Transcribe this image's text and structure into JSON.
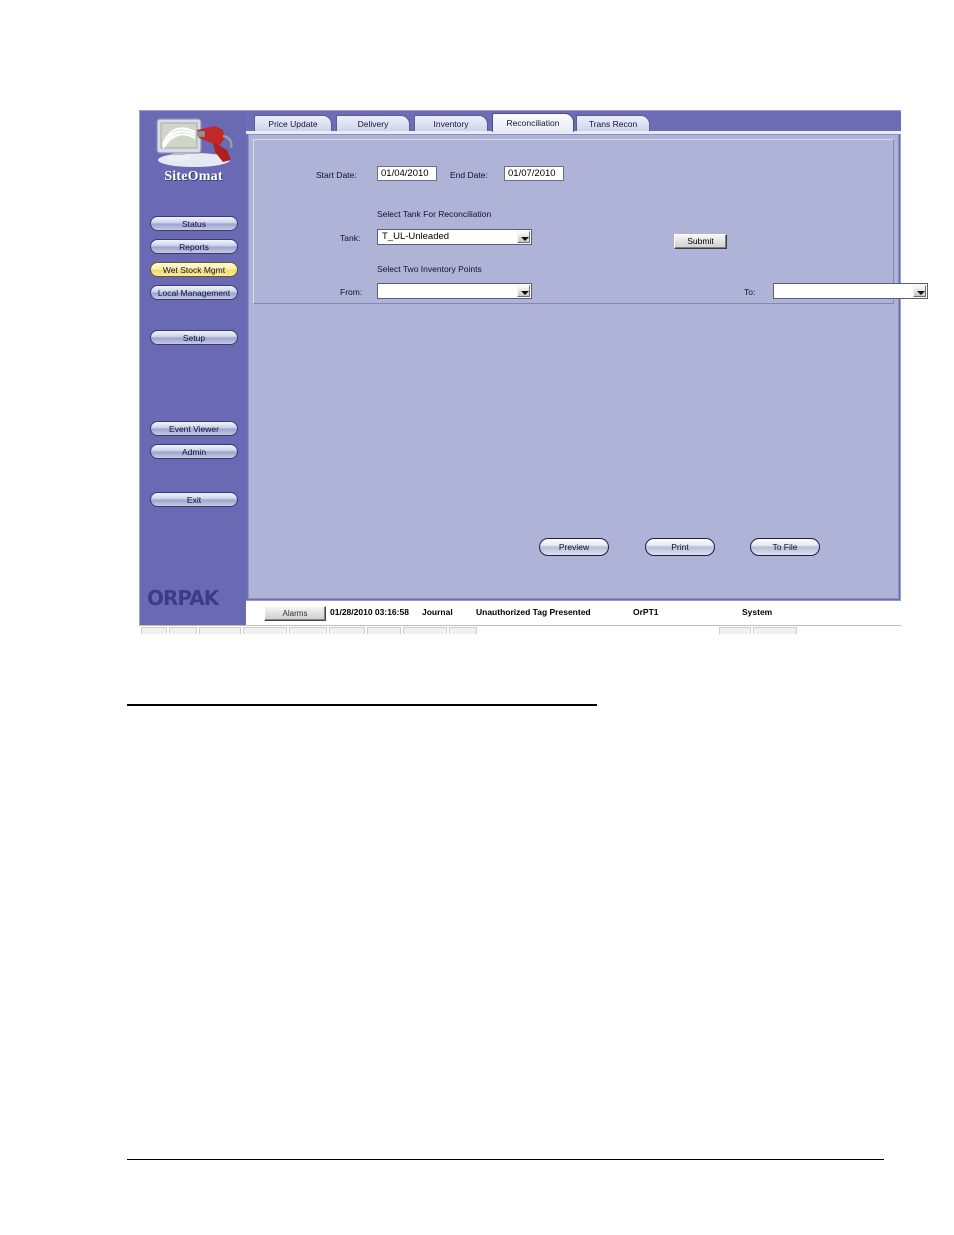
{
  "app": {
    "brand": "SiteOmat",
    "vendor_logo": "ORPAK",
    "logo_icon": "monitor-with-fuel-nozzle-icon"
  },
  "sidebar": {
    "items": [
      {
        "label": "Status",
        "active": false
      },
      {
        "label": "Reports",
        "active": false
      },
      {
        "label": "Wet Stock Mgmt",
        "active": true
      },
      {
        "label": "Local Management",
        "active": false
      },
      {
        "label": "Setup",
        "active": false
      },
      {
        "label": "Event Viewer",
        "active": false
      },
      {
        "label": "Admin",
        "active": false
      },
      {
        "label": "Exit",
        "active": false
      }
    ]
  },
  "tabs": [
    {
      "label": "Price Update",
      "active": false
    },
    {
      "label": "Delivery",
      "active": false
    },
    {
      "label": "Inventory",
      "active": false
    },
    {
      "label": "Reconciliation",
      "active": true
    },
    {
      "label": "Trans Recon",
      "active": false
    }
  ],
  "form": {
    "start_date_label": "Start Date:",
    "start_date_value": "01/04/2010",
    "end_date_label": "End Date:",
    "end_date_value": "01/07/2010",
    "tank_section_title": "Select Tank For Reconciliation",
    "tank_label": "Tank:",
    "tank_value": "T_UL-Unleaded",
    "submit_label": "Submit",
    "inventory_section_title": "Select Two Inventory Points",
    "from_label": "From:",
    "from_value": "",
    "to_label": "To:",
    "to_value": ""
  },
  "actions": {
    "preview_label": "Preview",
    "print_label": "Print",
    "to_file_label": "To File"
  },
  "statusbar": {
    "alarms_label": "Alarms",
    "timestamp": "01/28/2010 03:16:58",
    "category": "Journal",
    "message": "Unauthorized Tag Presented",
    "source": "OrPT1",
    "origin": "System"
  },
  "colors": {
    "sidebar": "#6a6ab4",
    "panel": "#aeb3d7",
    "tabbar": "#6d6db6",
    "active_nav": "#f2da6a",
    "logo_text": "#ffffff",
    "orpak": "#3b3b8a"
  }
}
